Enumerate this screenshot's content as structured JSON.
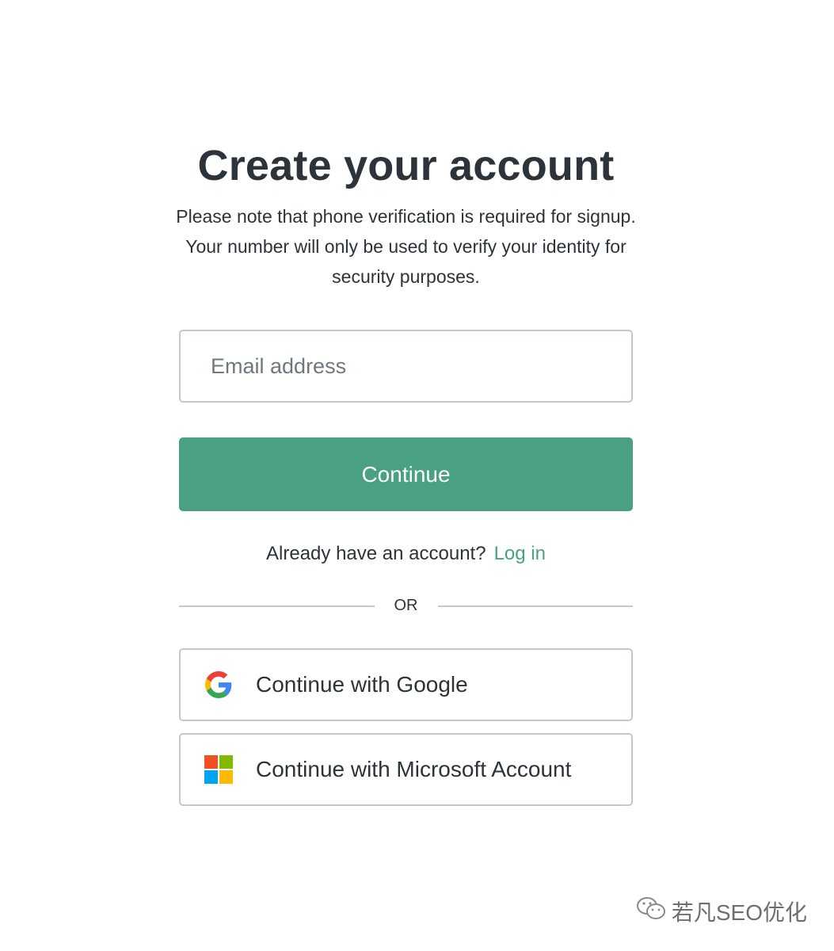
{
  "header": {
    "title": "Create your account",
    "subtitle": "Please note that phone verification is required for signup. Your number will only be used to verify your identity for security purposes."
  },
  "form": {
    "email_placeholder": "Email address",
    "email_value": "",
    "continue_label": "Continue"
  },
  "login": {
    "prompt": "Already have an account?",
    "link_label": "Log in"
  },
  "divider": {
    "label": "OR"
  },
  "social": [
    {
      "label": "Continue with Google",
      "icon": "google-icon"
    },
    {
      "label": "Continue with Microsoft Account",
      "icon": "microsoft-icon"
    }
  ],
  "watermark": {
    "text": "若凡SEO优化",
    "icon": "wechat-icon"
  },
  "colors": {
    "accent": "#4aa181",
    "text": "#2d333a",
    "border": "#c2c8d0",
    "google_blue": "#4285f4",
    "google_red": "#ea4335",
    "google_yellow": "#fbbc05",
    "google_green": "#34a853",
    "ms_red": "#f25022",
    "ms_green": "#7fba00",
    "ms_blue": "#00a4ef",
    "ms_yellow": "#ffb900"
  }
}
